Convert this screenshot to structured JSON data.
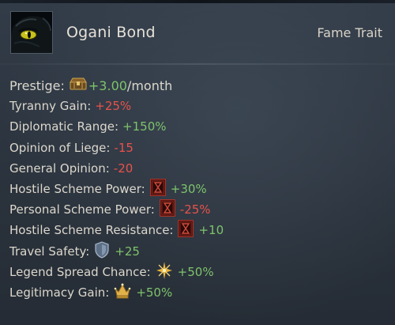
{
  "header": {
    "title": "Ogani Bond",
    "type_label": "Fame Trait",
    "portrait_icon": "black-panther-eye-icon"
  },
  "stats": [
    {
      "label": "Prestige:",
      "icon": "prestige-chest-icon",
      "value": "+3.00",
      "suffix": "/month",
      "polarity": "positive"
    },
    {
      "label": "Tyranny Gain:",
      "value": "+25%",
      "polarity": "negative"
    },
    {
      "label": "Diplomatic Range:",
      "value": "+150%",
      "polarity": "positive"
    },
    {
      "label": "Opinion of Liege:",
      "value": "-15",
      "polarity": "negative"
    },
    {
      "label": "General Opinion:",
      "value": "-20",
      "polarity": "negative"
    },
    {
      "label": "Hostile Scheme Power:",
      "icon": "hourglass-scheme-icon",
      "value": "+30%",
      "polarity": "positive"
    },
    {
      "label": "Personal Scheme Power:",
      "icon": "hourglass-scheme-icon",
      "value": "-25%",
      "polarity": "negative"
    },
    {
      "label": "Hostile Scheme Resistance:",
      "icon": "hourglass-scheme-icon",
      "value": "+10",
      "polarity": "positive"
    },
    {
      "label": "Travel Safety:",
      "icon": "shield-icon",
      "value": "+25",
      "polarity": "positive"
    },
    {
      "label": "Legend Spread Chance:",
      "icon": "star-burst-icon",
      "value": "+50%",
      "polarity": "positive"
    },
    {
      "label": "Legitimacy Gain:",
      "icon": "crown-icon",
      "value": "+50%",
      "polarity": "positive"
    }
  ],
  "colors": {
    "positive": "#7ec36b",
    "negative": "#e8524a",
    "text": "#dcd7cc",
    "background": "#2b343f"
  }
}
